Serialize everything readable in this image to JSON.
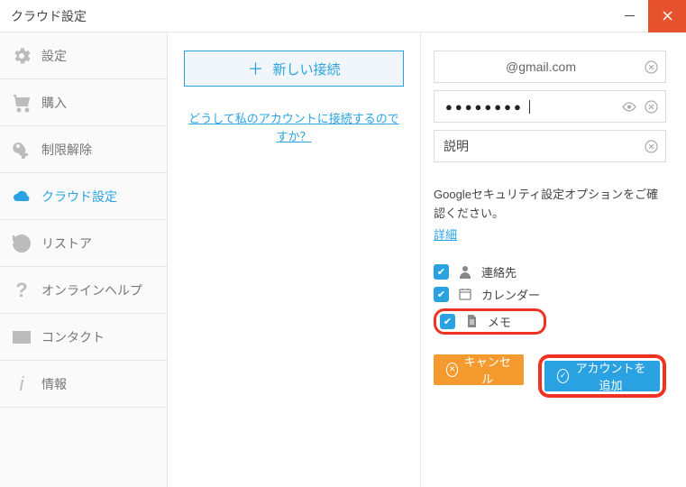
{
  "window": {
    "title": "クラウド設定"
  },
  "sidebar": {
    "items": [
      {
        "label": "設定",
        "name": "sidebar-item-settings"
      },
      {
        "label": "購入",
        "name": "sidebar-item-purchase"
      },
      {
        "label": "制限解除",
        "name": "sidebar-item-unlock"
      },
      {
        "label": "クラウド設定",
        "name": "sidebar-item-cloud",
        "active": true
      },
      {
        "label": "リストア",
        "name": "sidebar-item-restore"
      },
      {
        "label": "オンラインヘルプ",
        "name": "sidebar-item-help"
      },
      {
        "label": "コンタクト",
        "name": "sidebar-item-contact"
      },
      {
        "label": "情報",
        "name": "sidebar-item-info"
      }
    ]
  },
  "left": {
    "new_connection": "新しい接続",
    "why_link": "どうして私のアカウントに接続するのですか？"
  },
  "form": {
    "email": "@gmail.com",
    "password_mask": "●●●●●●●●",
    "description": "説明"
  },
  "notice": {
    "text": "Googleセキュリティ設定オプションをご確認ください。",
    "details": "詳細"
  },
  "checks": {
    "contacts": "連絡先",
    "calendar": "カレンダー",
    "notes": "メモ"
  },
  "buttons": {
    "cancel": "キャンセル",
    "add": "アカウントを追加"
  }
}
